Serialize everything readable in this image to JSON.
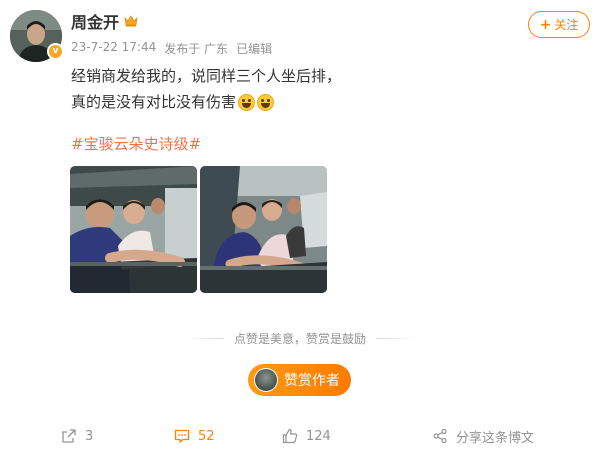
{
  "post": {
    "author": {
      "name": "周金开",
      "verified_badge": "v",
      "badge_icon": "crown-icon",
      "avatar_icon": "avatar"
    },
    "meta": {
      "datetime": "23-7-22 17:44",
      "location": "发布于 广东",
      "edited": "已编辑"
    },
    "follow_label": "关注",
    "text_lines": [
      "经销商发给我的，说同样三个人坐后排，",
      "真的是没有对比没有伤害"
    ],
    "emojis": [
      "laugh-tears-emoji",
      "laugh-tears-emoji"
    ],
    "hashtag": "#宝骏云朵史诗级#",
    "images": [
      {
        "name": "photo-people-in-car-1"
      },
      {
        "name": "photo-people-in-car-2"
      }
    ],
    "divider_text": "点赞是美意，赞赏是鼓励",
    "reward_label": "赞赏作者",
    "actions": {
      "repost_count": "3",
      "comment_count": "52",
      "like_count": "124",
      "share_label": "分享这条博文"
    }
  },
  "colors": {
    "accent": "#ff8200",
    "hashtag": "#eb7350",
    "meta": "#939393",
    "text": "#333333"
  }
}
